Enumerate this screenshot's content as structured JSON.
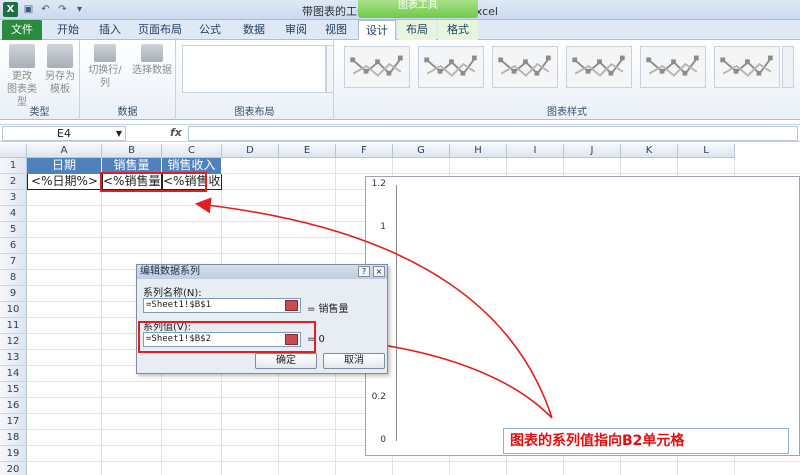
{
  "window": {
    "title": "带图表的工作表.xlsx - Microsoft Excel",
    "context_tab_header": "图表工具",
    "app_icon": "X"
  },
  "tabs": [
    {
      "label": "文件"
    },
    {
      "label": "开始"
    },
    {
      "label": "插入"
    },
    {
      "label": "页面布局"
    },
    {
      "label": "公式"
    },
    {
      "label": "数据"
    },
    {
      "label": "审阅"
    },
    {
      "label": "视图"
    },
    {
      "label": "设计"
    },
    {
      "label": "布局"
    },
    {
      "label": "格式"
    }
  ],
  "ribbon": {
    "groups": {
      "type": "类型",
      "data": "数据",
      "layout": "图表布局",
      "styles": "图表样式"
    },
    "buttons": {
      "change_type_1": "更改",
      "change_type_2": "图表类型",
      "save_template_1": "另存为",
      "save_template_2": "模板",
      "switch_row_col": "切换行/列",
      "select_data": "选择数据"
    }
  },
  "formula_bar": {
    "name_box": "E4",
    "fx": "fx",
    "value": ""
  },
  "grid": {
    "columns": [
      "A",
      "B",
      "C",
      "D",
      "E",
      "F",
      "G",
      "H",
      "I",
      "J",
      "K",
      "L"
    ],
    "rows": [
      "1",
      "2",
      "3",
      "4",
      "5",
      "6",
      "7",
      "8",
      "9",
      "10",
      "11",
      "12",
      "13",
      "14",
      "15",
      "16",
      "17",
      "18",
      "19",
      "20"
    ],
    "cells": {
      "A1": "日期",
      "B1": "销售量",
      "C1": "销售收入",
      "A2": "<%日期%>",
      "B2": "<%销售量%>",
      "C2": "<%销售收入%>"
    }
  },
  "chart": {
    "y_ticks": [
      "1.2",
      "1",
      "0.8",
      "0.6",
      "0.4",
      "0.2",
      "0"
    ]
  },
  "dialog": {
    "title": "编辑数据系列",
    "help": "?",
    "close": "×",
    "series_name_label": "系列名称(N):",
    "series_name_value": "=Sheet1!$B$1",
    "series_name_result": "= 销售量",
    "series_values_label": "系列值(V):",
    "series_values_value": "=Sheet1!$B$2",
    "series_values_result": "= 0",
    "ok": "确定",
    "cancel": "取消"
  },
  "annotation": {
    "text": "图表的系列值指向B2单元格"
  },
  "colors": {
    "header_fill": "#4f81bd",
    "highlight_red": "#e02020",
    "file_tab": "#2a8a3e"
  }
}
